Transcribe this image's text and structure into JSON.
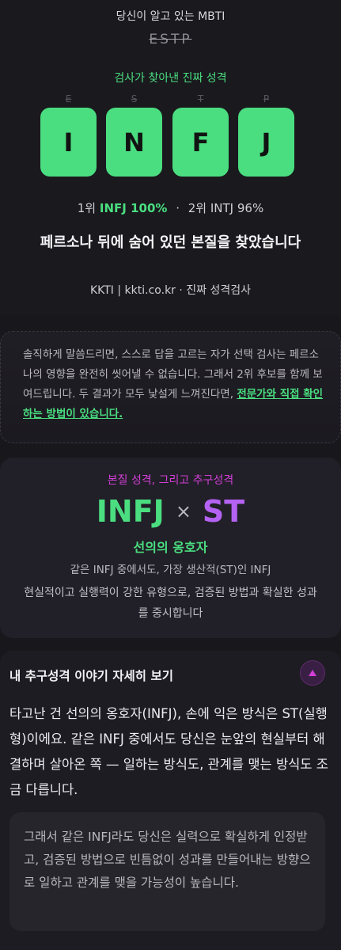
{
  "hero": {
    "known_label": "당신이 알고 있는 MBTI",
    "known_value": "ESTP",
    "real_label": "검사가 찾아낸 진짜 성격",
    "struck_letters": [
      "E",
      "S",
      "T",
      "P"
    ],
    "tiles": [
      "I",
      "N",
      "F",
      "J"
    ],
    "rank": {
      "first_prefix": "1위",
      "first_value": "INFJ 100%",
      "separator": "·",
      "second": "2위 INTJ 96%"
    },
    "headline": "페르소나 뒤에 숨어 있던 본질을 찾았습니다",
    "brand": "KKTI | kkti.co.kr · 진짜 성격검사"
  },
  "notice": {
    "text": "솔직하게 말씀드리면, 스스로 답을 고르는 자가 선택 검사는 페르소나의 영향을 완전히 씻어낼 수 없습니다. 그래서 2위 후보를 함께 보여드립니다. 두 결과가 모두 낯설게 느껴진다면, ",
    "link": "전문가와 직접 확인하는 방법이 있습니다."
  },
  "combo": {
    "label": "본질 성격, 그리고 추구성격",
    "type_main": "INFJ",
    "times": "×",
    "type_pursuit": "ST",
    "nickname": "선의의 옹호자",
    "subtitle": "같은 INFJ 중에서도, 가장 생산적(ST)인 INFJ",
    "description": "현실적이고 실행력이 강한 유형으로, 검증된 방법과 확실한 성과를 중시합니다"
  },
  "story": {
    "title": "내 추구성격 이야기 자세히 보기",
    "toggle_icon": "chevron-up-icon",
    "body": "타고난 건 선의의 옹호자(INFJ), 손에 익은 방식은 ST(실행형)이에요. 같은 INFJ 중에서도 당신은 눈앞의 현실부터 해결하며 살아온 쪽 — 일하는 방식도, 관계를 맺는 방식도 조금 다릅니다.",
    "quote": "그래서 같은 INFJ라도 당신은 실력으로 확실하게 인정받고, 검증된 방법으로 빈틈없이 성과를 만들어내는 방향으로 일하고 관계를 맺을 가능성이 높습니다."
  },
  "colors": {
    "accent_green": "#4ade80",
    "accent_purple": "#b462f2",
    "accent_magenta": "#d13fd6",
    "background": "#18171c"
  }
}
